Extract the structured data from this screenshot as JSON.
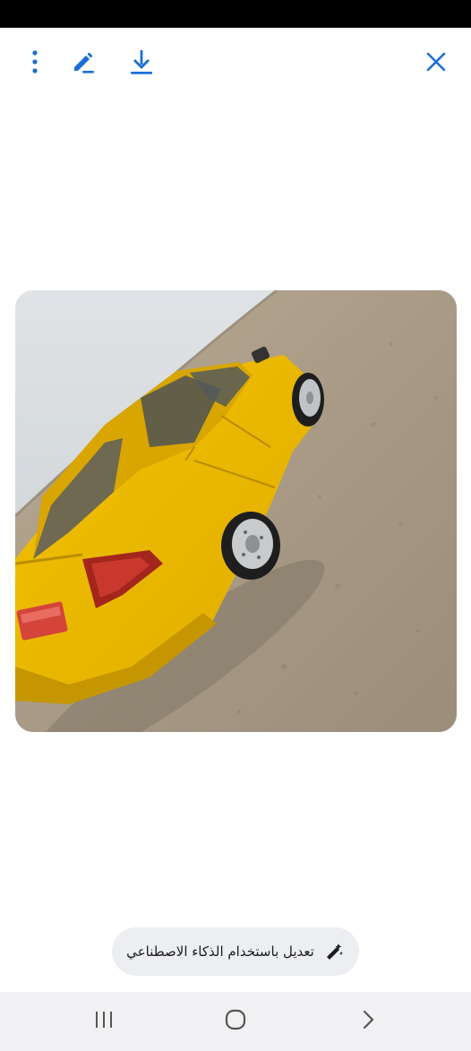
{
  "toolbar": {
    "more_icon": "more-vertical-icon",
    "edit_icon": "pencil-icon",
    "download_icon": "download-icon",
    "close_icon": "close-icon",
    "accent_color": "#1a6fd6"
  },
  "photo": {
    "subject": "yellow sedan car on dirt ground"
  },
  "ai_edit": {
    "label": "تعديل باستخدام الذكاء الاصطناعي",
    "icon": "magic-wand-icon"
  },
  "nav": {
    "recents_icon": "recent-apps-icon",
    "home_icon": "home-icon",
    "back_icon": "back-chevron-icon"
  }
}
